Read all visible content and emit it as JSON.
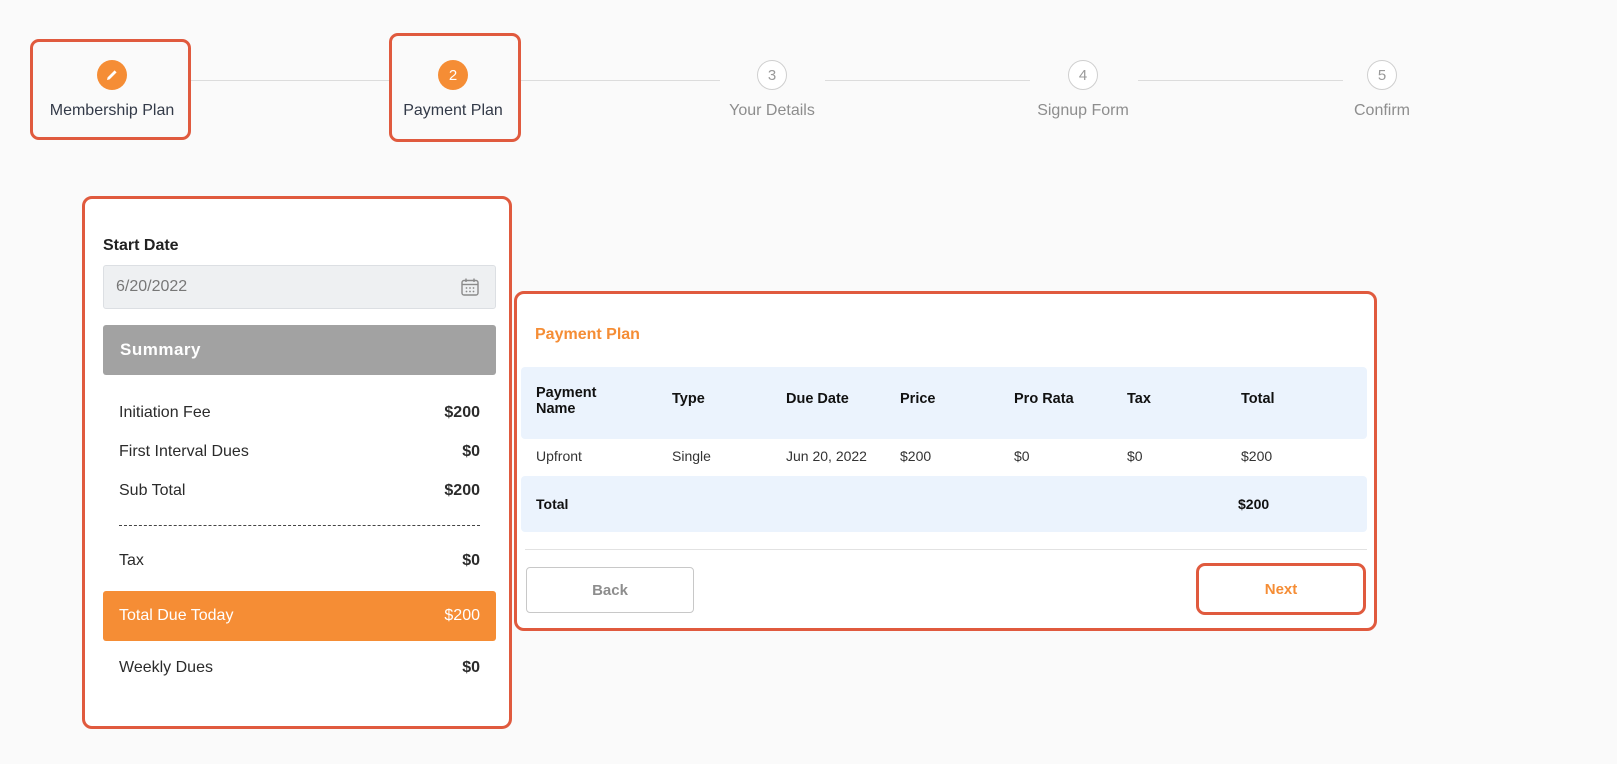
{
  "steps": [
    {
      "number": "",
      "label": "Membership Plan",
      "icon": "pencil-icon",
      "state": "completed"
    },
    {
      "number": "2",
      "label": "Payment Plan",
      "state": "active"
    },
    {
      "number": "3",
      "label": "Your Details",
      "state": "inactive"
    },
    {
      "number": "4",
      "label": "Signup Form",
      "state": "inactive"
    },
    {
      "number": "5",
      "label": "Confirm",
      "state": "inactive"
    }
  ],
  "summary": {
    "start_date_label": "Start Date",
    "start_date_value": "6/20/2022",
    "header": "Summary",
    "rows": [
      {
        "label": "Initiation Fee",
        "value": "$200"
      },
      {
        "label": "First Interval Dues",
        "value": "$0"
      },
      {
        "label": "Sub Total",
        "value": "$200"
      }
    ],
    "tax": {
      "label": "Tax",
      "value": "$0"
    },
    "total_due": {
      "label": "Total Due Today",
      "value": "$200"
    },
    "weekly_dues": {
      "label": "Weekly Dues",
      "value": "$0"
    }
  },
  "payment_plan": {
    "title": "Payment Plan",
    "columns": [
      "Payment Name",
      "Type",
      "Due Date",
      "Price",
      "Pro Rata",
      "Tax",
      "Total"
    ],
    "rows": [
      [
        "Upfront",
        "Single",
        "Jun 20, 2022",
        "$200",
        "$0",
        "$0",
        "$200"
      ]
    ],
    "total_label": "Total",
    "total_value": "$200",
    "back_label": "Back",
    "next_label": "Next"
  },
  "colors": {
    "accent": "#f58d35",
    "highlight": "#e05a3e",
    "summary_header": "#a2a2a2",
    "table_header_bg": "#ebf3fd"
  }
}
